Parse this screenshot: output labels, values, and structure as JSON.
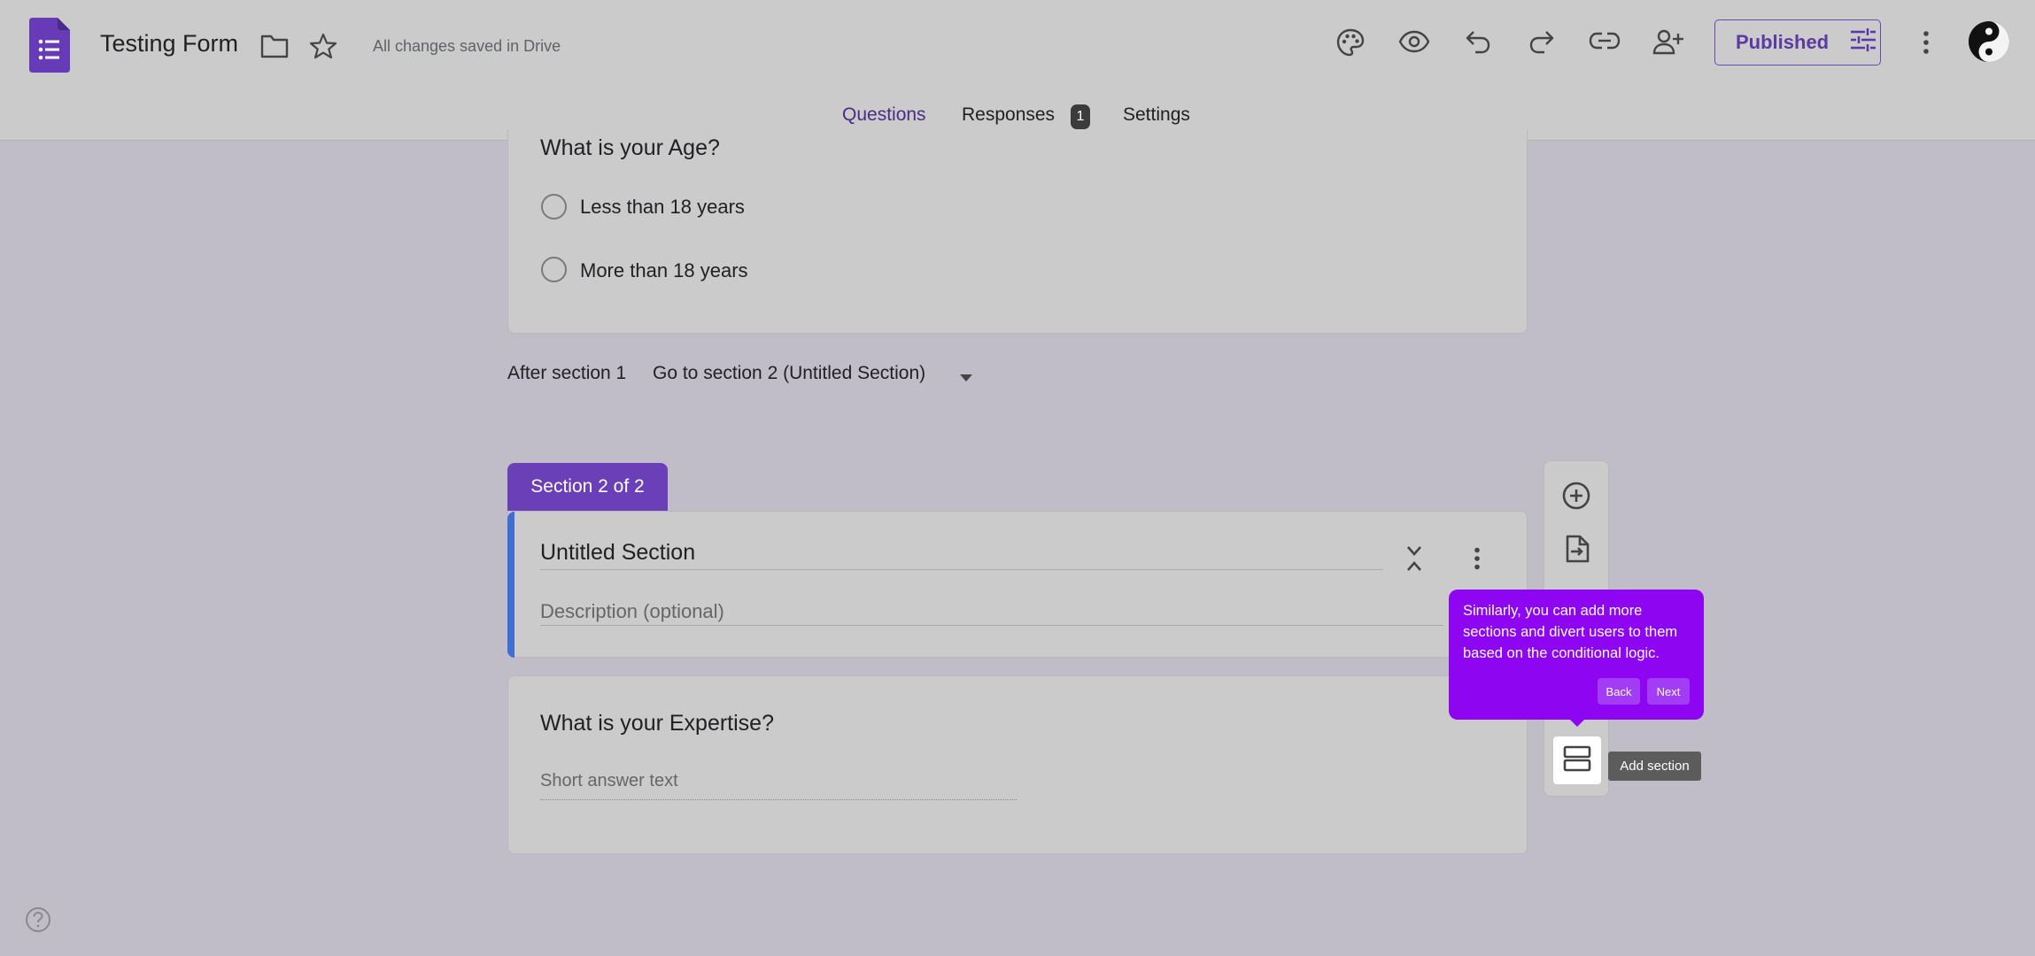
{
  "header": {
    "doc_title": "Testing Form",
    "save_status": "All changes saved in Drive",
    "publish_label": "Published",
    "icons": [
      "forms-logo-icon",
      "folder-icon",
      "star-icon",
      "palette-icon",
      "eye-icon",
      "undo-icon",
      "redo-icon",
      "link-icon",
      "add-person-icon",
      "tune-icon",
      "more-vert-icon",
      "avatar"
    ]
  },
  "tabs": [
    {
      "label": "Questions",
      "active": true
    },
    {
      "label": "Responses",
      "badge": "1"
    },
    {
      "label": "Settings"
    }
  ],
  "section1": {
    "question_title": "What is your Age?",
    "options": [
      "Less than 18 years",
      "More than 18 years"
    ],
    "after_label": "After section 1",
    "goto_value": "Go to section 2 (Untitled Section)"
  },
  "section2": {
    "tab_label": "Section 2 of 2",
    "title": "Untitled Section",
    "description_placeholder": "Description (optional)",
    "question_title": "What is your Expertise?",
    "short_answer_placeholder": "Short answer text"
  },
  "toolbar": {
    "icons": [
      "add-circle-icon",
      "import-icon",
      "add-section-icon"
    ],
    "add_section_tooltip": "Add section"
  },
  "popup": {
    "text": "Similarly, you can add more sections and divert users to them based on the conditional logic.",
    "back_label": "Back",
    "next_label": "Next",
    "background": "#8d05f1"
  },
  "colors": {
    "accent": "#673ab7",
    "section_bar": "#3f6fd6"
  }
}
